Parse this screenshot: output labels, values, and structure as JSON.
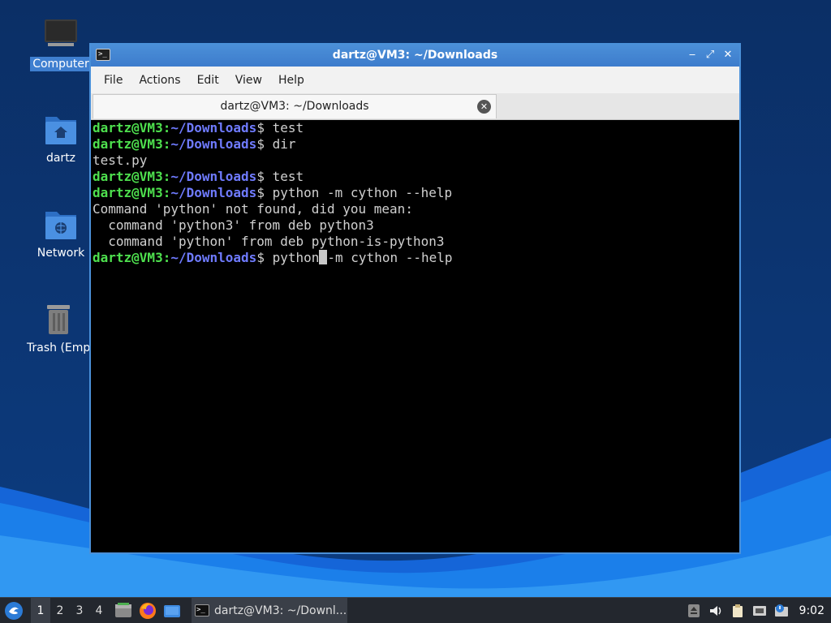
{
  "desktop": {
    "icons": [
      {
        "label": "Computer"
      },
      {
        "label": "dartz"
      },
      {
        "label": "Network"
      },
      {
        "label": "Trash (Empt"
      }
    ]
  },
  "window": {
    "title": "dartz@VM3: ~/Downloads",
    "controls": {
      "minimize": "‒",
      "maximize": "⤢",
      "close": "✕"
    },
    "menu": [
      "File",
      "Actions",
      "Edit",
      "View",
      "Help"
    ],
    "tab": {
      "label": "dartz@VM3: ~/Downloads",
      "close": "✕"
    }
  },
  "terminal": {
    "user_host": "dartz@VM3",
    "sep": ":",
    "path": "~/Downloads",
    "prompt_char": "$",
    "lines": [
      {
        "type": "cmd",
        "text": " test"
      },
      {
        "type": "cmd",
        "text": " dir"
      },
      {
        "type": "out",
        "text": "test.py"
      },
      {
        "type": "cmd",
        "text": " test"
      },
      {
        "type": "cmd",
        "text": " python -m cython --help"
      },
      {
        "type": "out",
        "text": "Command 'python' not found, did you mean:"
      },
      {
        "type": "out",
        "text": "  command 'python3' from deb python3"
      },
      {
        "type": "out",
        "text": "  command 'python' from deb python-is-python3"
      }
    ],
    "current": {
      "before_cursor": " python",
      "cursor": " ",
      "after_cursor": "-m cython --help"
    }
  },
  "taskbar": {
    "workspaces": [
      "1",
      "2",
      "3",
      "4"
    ],
    "active_workspace": "1",
    "task_label": "dartz@VM3: ~/Downl...",
    "clock": "9:02"
  },
  "colors": {
    "accent": "#4a90d9",
    "prompt_user": "#4ee04e",
    "prompt_path": "#6f7bff",
    "terminal_bg": "#000000",
    "taskbar_bg": "#23272e"
  }
}
